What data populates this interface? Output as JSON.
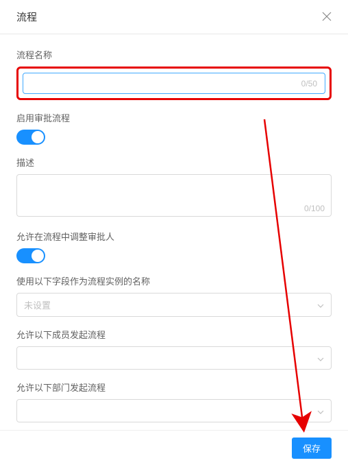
{
  "modal": {
    "title": "流程"
  },
  "fields": {
    "name": {
      "label": "流程名称",
      "value": "",
      "count": "0/50"
    },
    "enableApproval": {
      "label": "启用审批流程"
    },
    "description": {
      "label": "描述",
      "value": "",
      "count": "0/100"
    },
    "adjustApprover": {
      "label": "允许在流程中调整审批人"
    },
    "instanceNameField": {
      "label": "使用以下字段作为流程实例的名称",
      "placeholder": "未设置"
    },
    "allowedMembers": {
      "label": "允许以下成员发起流程"
    },
    "allowedDepartments": {
      "label": "允许以下部门发起流程"
    }
  },
  "footer": {
    "save": "保存"
  }
}
